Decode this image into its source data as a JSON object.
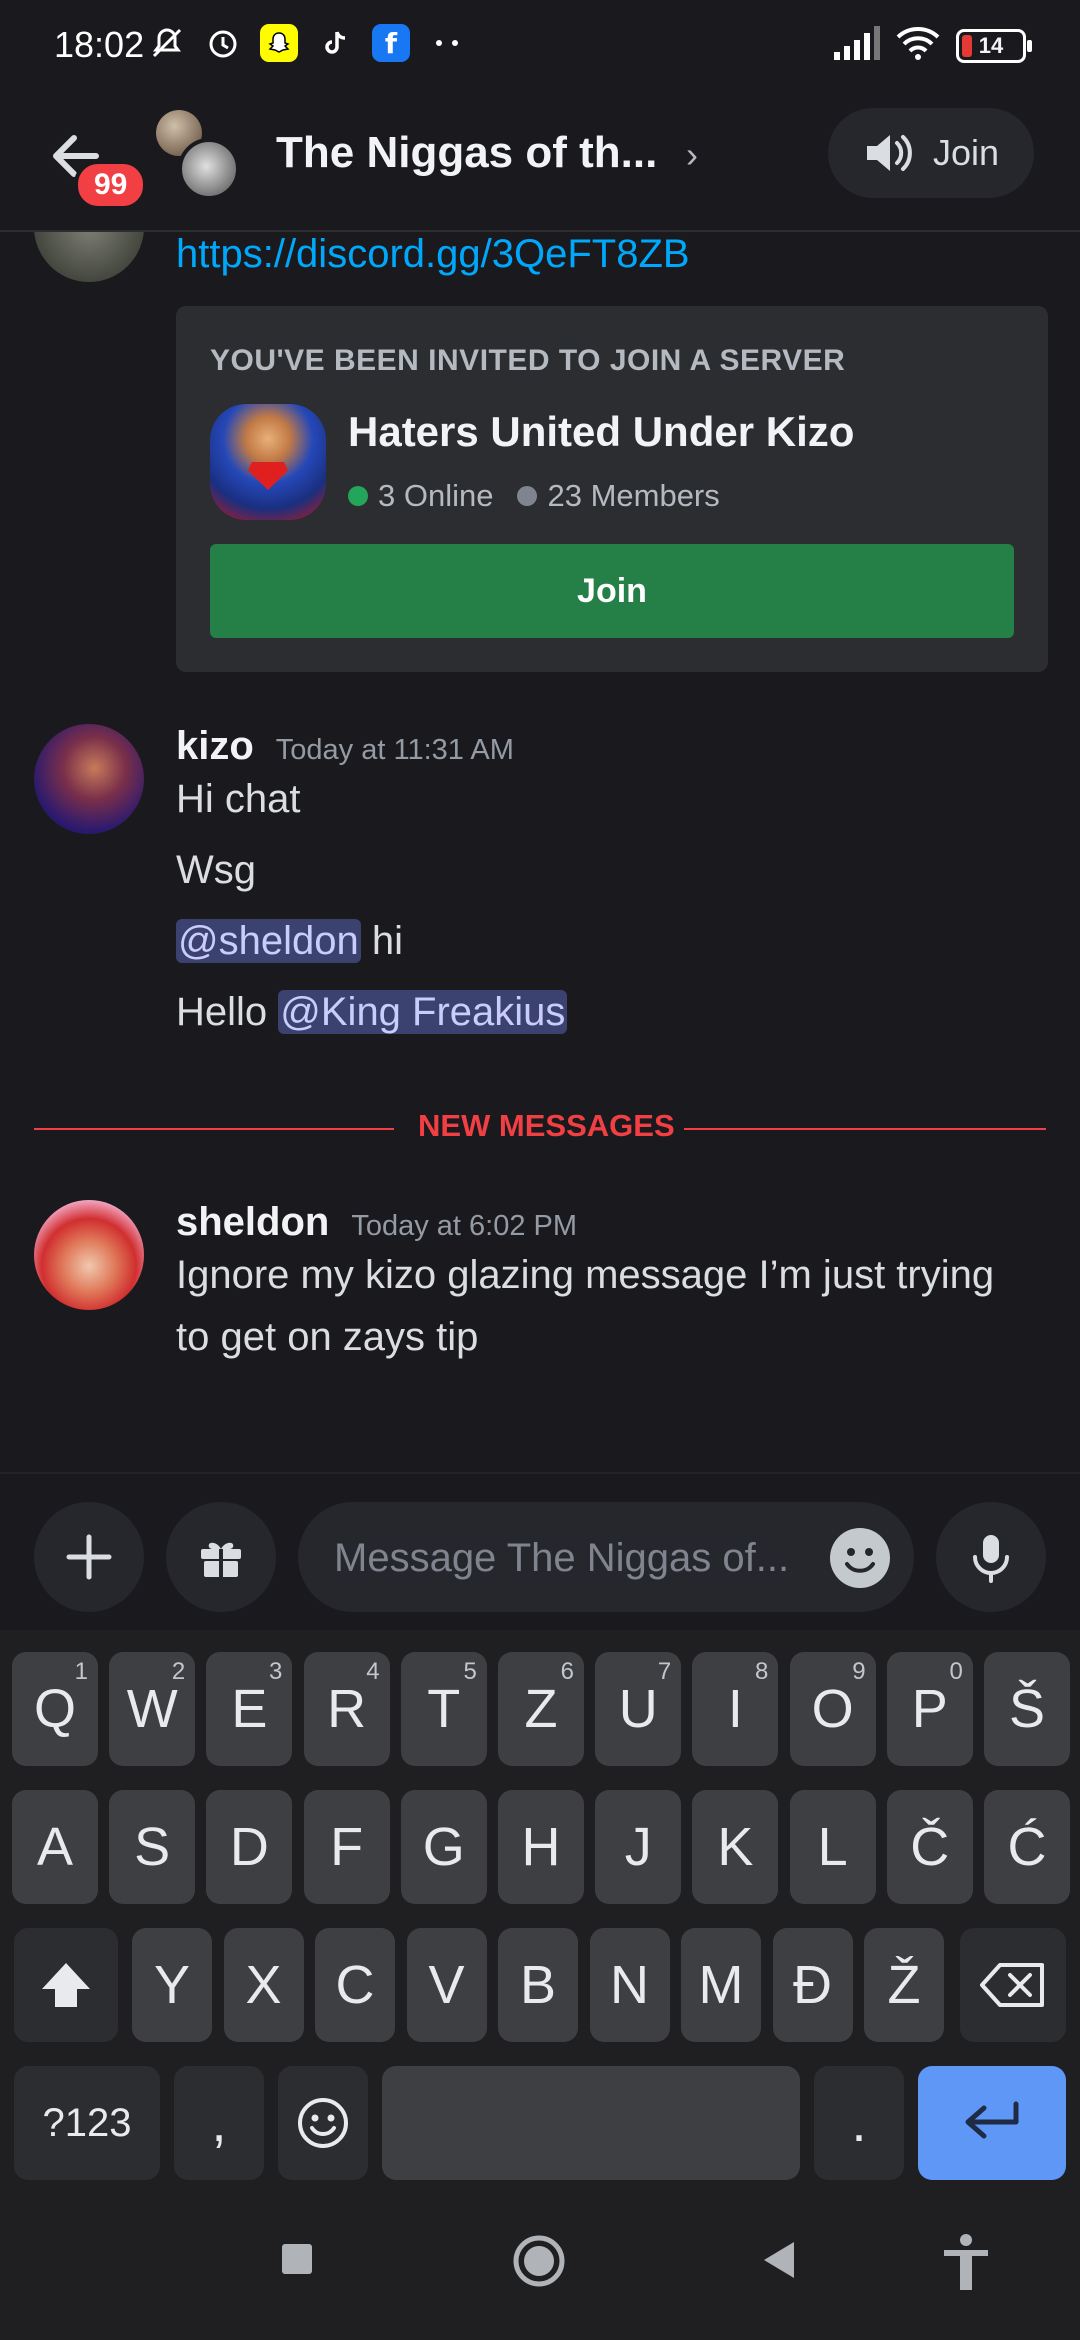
{
  "status_bar": {
    "time": "18:02",
    "battery": "14",
    "icons": [
      "mute-icon",
      "alarm-icon",
      "snapchat-icon",
      "tiktok-icon",
      "facebook-icon",
      "more-dots-icon",
      "signal-icon",
      "wifi-icon",
      "battery-icon"
    ]
  },
  "header": {
    "title": "The Niggas of th...",
    "unread_badge": "99",
    "join_label": "Join"
  },
  "previous_message": {
    "link": "https://discord.gg/3QeFT8ZB"
  },
  "invite": {
    "heading": "YOU'VE BEEN INVITED TO JOIN A SERVER",
    "server_name": "Haters United Under Kizo",
    "online": "3 Online",
    "members": "23 Members",
    "join_label": "Join",
    "online_color": "#23a55a",
    "members_color": "#80848e"
  },
  "messages": [
    {
      "author": "kizo",
      "time": "Today at 11:31 AM",
      "lines": {
        "l1": "Hi chat",
        "l2": "Wsg",
        "l3_mention": "@sheldon",
        "l3_text": " hi",
        "l4_text": "Hello ",
        "l4_mention": "@King Freakius"
      }
    },
    {
      "author": "sheldon",
      "time": "Today at 6:02 PM",
      "text_line1": "Ignore my kizo glazing message I’m just trying",
      "text_line2": "to get on zays tip"
    }
  ],
  "new_messages_divider": "NEW MESSAGES",
  "composer": {
    "placeholder": "Message The Niggas of..."
  },
  "keyboard": {
    "row1": [
      {
        "k": "Q",
        "h": "1"
      },
      {
        "k": "W",
        "h": "2"
      },
      {
        "k": "E",
        "h": "3"
      },
      {
        "k": "R",
        "h": "4"
      },
      {
        "k": "T",
        "h": "5"
      },
      {
        "k": "Z",
        "h": "6"
      },
      {
        "k": "U",
        "h": "7"
      },
      {
        "k": "I",
        "h": "8"
      },
      {
        "k": "O",
        "h": "9"
      },
      {
        "k": "P",
        "h": "0"
      },
      {
        "k": "Š",
        "h": ""
      }
    ],
    "row2": [
      "A",
      "S",
      "D",
      "F",
      "G",
      "H",
      "J",
      "K",
      "L",
      "Č",
      "Ć"
    ],
    "row3": [
      "Y",
      "X",
      "C",
      "V",
      "B",
      "N",
      "M",
      "Đ",
      "Ž"
    ],
    "symbols_label": "?123",
    "comma": ",",
    "period": "."
  },
  "colors": {
    "accent": "#5865f2",
    "link": "#00a8fc",
    "join_green": "#248046",
    "new_messages_red": "#f23f43",
    "enter_blue": "#5e97f6"
  }
}
